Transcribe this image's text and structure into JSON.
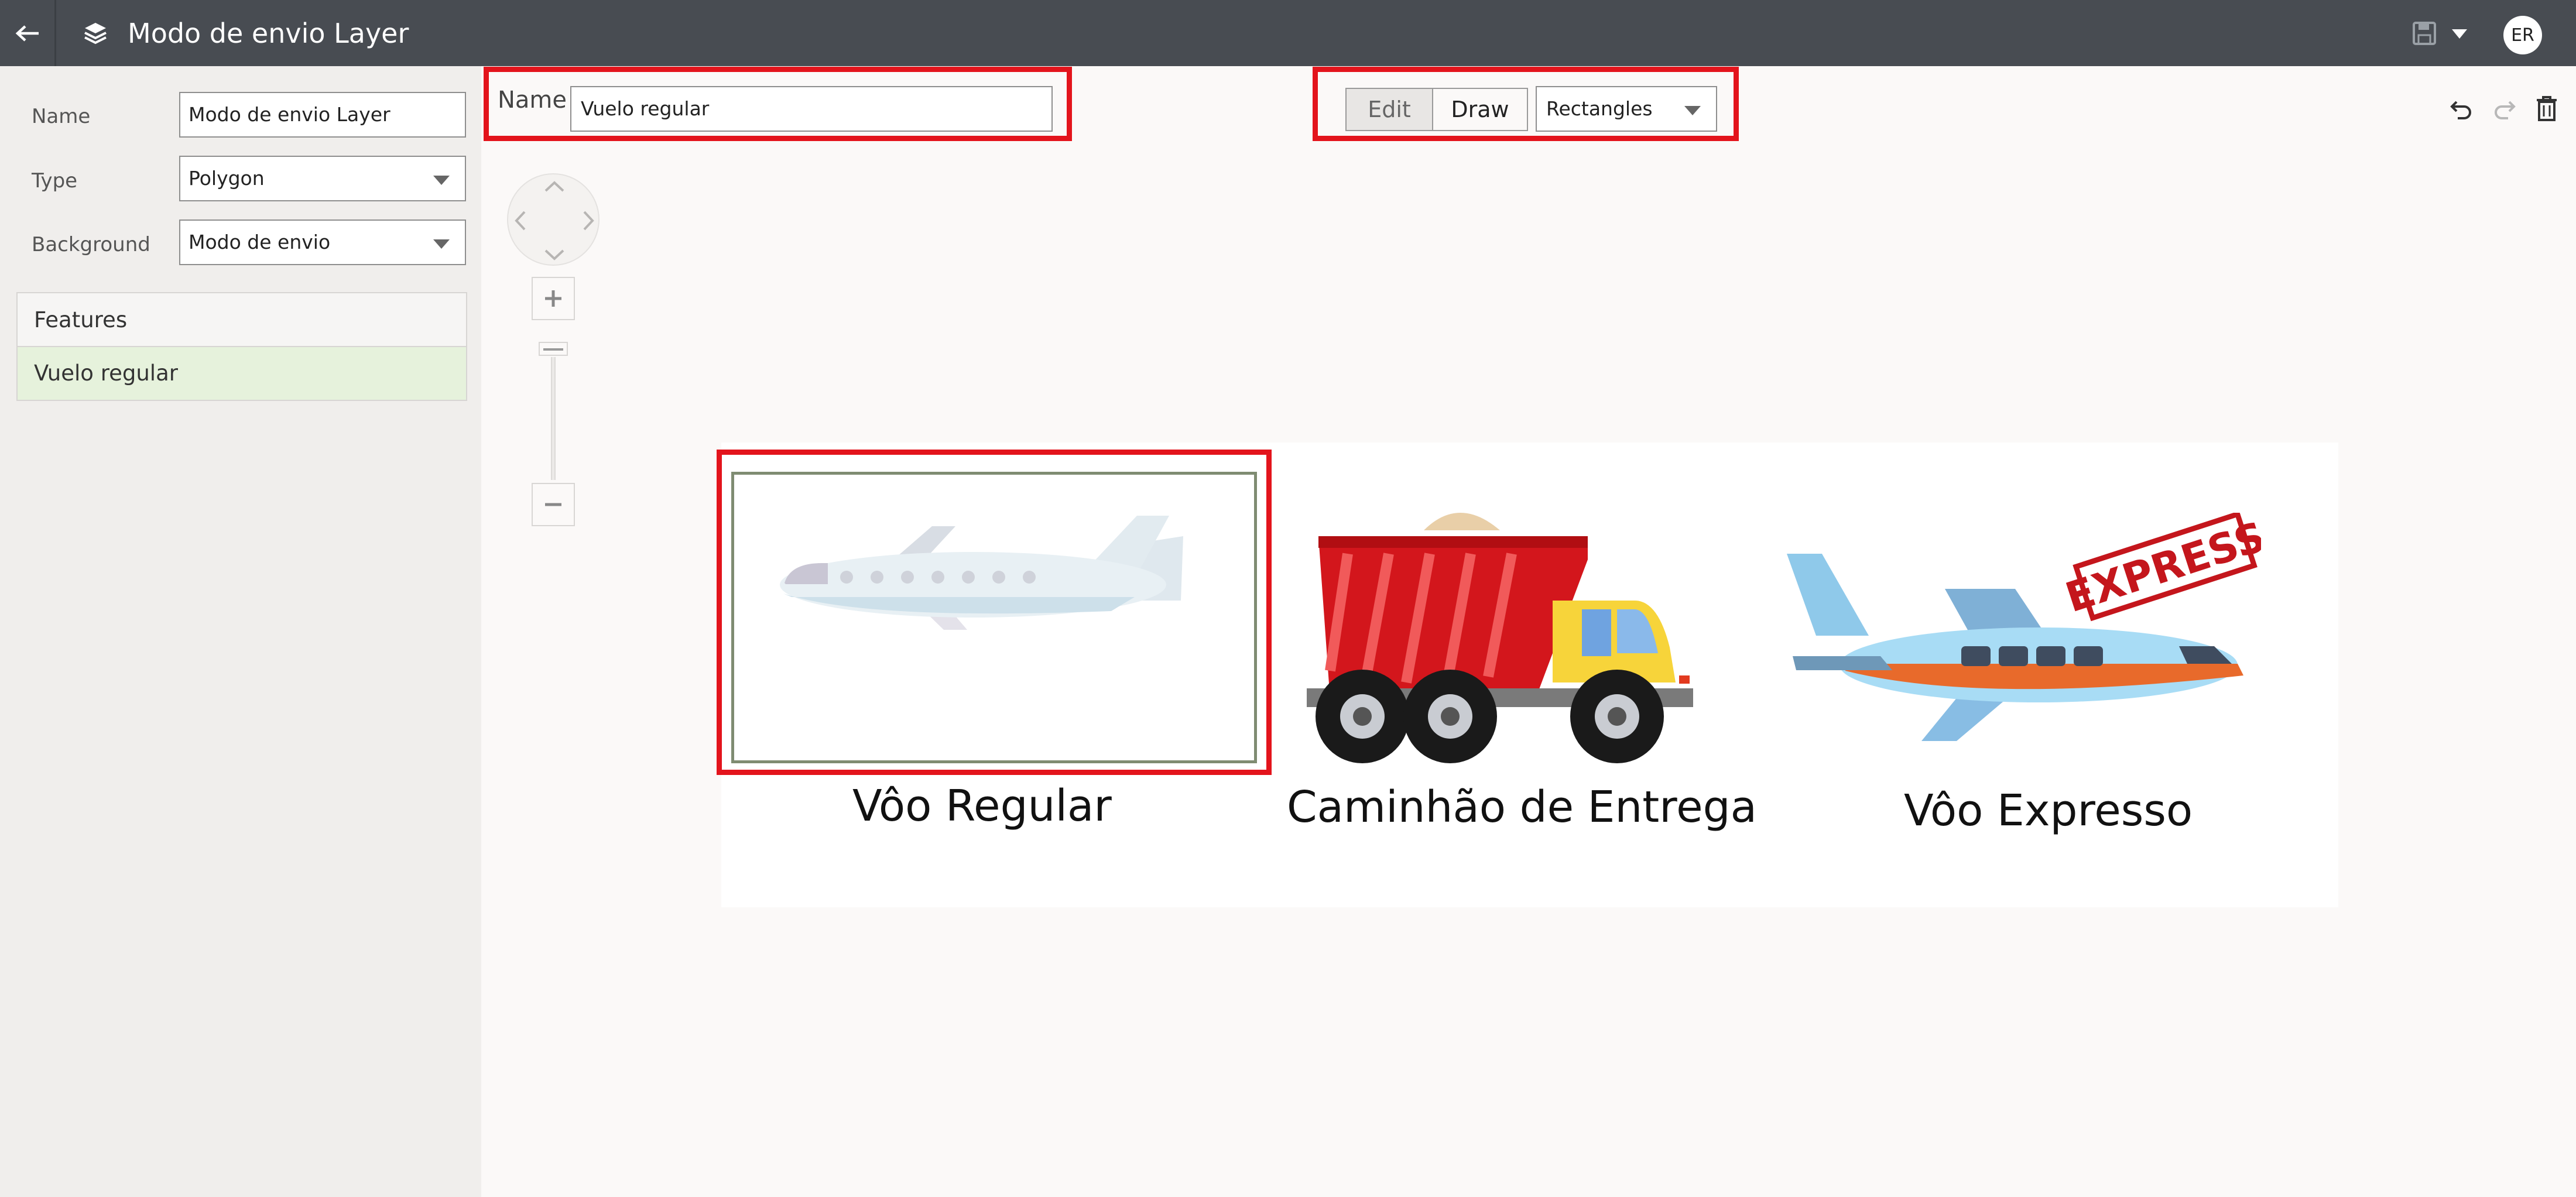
{
  "topbar": {
    "title": "Modo de envio Layer",
    "avatar_initials": "ER",
    "back_icon": "arrow-left-icon",
    "layers_icon": "layers-icon",
    "save_icon": "save-icon"
  },
  "properties": {
    "name_label": "Name",
    "name_value": "Modo de envio Layer",
    "type_label": "Type",
    "type_value": "Polygon",
    "background_label": "Background",
    "background_value": "Modo de envio"
  },
  "features": {
    "header": "Features",
    "items": [
      "Vuelo regular"
    ]
  },
  "toolbar": {
    "name_label": "Name",
    "name_value": "Vuelo regular",
    "edit_label": "Edit",
    "draw_label": "Draw",
    "shape_select": "Rectangles"
  },
  "canvas": {
    "captions": [
      "Vôo Regular",
      "Caminhão de Entrega",
      "Vôo Expresso"
    ],
    "express_stamp": "EXPRESS"
  },
  "colors": {
    "topbar": "#484c52",
    "highlight": "#e3141c",
    "selected_feature": "#e6f2dc"
  }
}
